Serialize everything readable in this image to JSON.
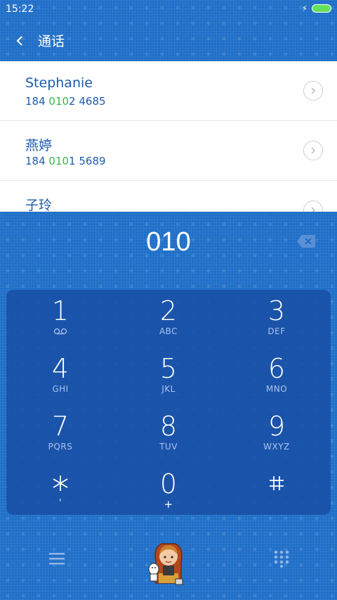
{
  "status": {
    "time": "15:22"
  },
  "header": {
    "title": "通话"
  },
  "results": [
    {
      "name": "Stephanie",
      "number_prefix": "184 ",
      "number_match": "010",
      "number_suffix": "2 4685"
    },
    {
      "name": "燕婷",
      "number_prefix": "184 ",
      "number_match": "010",
      "number_suffix": "1 5689"
    },
    {
      "name": "子玲",
      "number_prefix": "",
      "number_match": "",
      "number_suffix": ""
    }
  ],
  "dial": {
    "number": "010"
  },
  "keypad": {
    "keys": [
      {
        "digit": "1",
        "letters": ""
      },
      {
        "digit": "2",
        "letters": "ABC"
      },
      {
        "digit": "3",
        "letters": "DEF"
      },
      {
        "digit": "4",
        "letters": "GHI"
      },
      {
        "digit": "5",
        "letters": "JKL"
      },
      {
        "digit": "6",
        "letters": "MNO"
      },
      {
        "digit": "7",
        "letters": "PQRS"
      },
      {
        "digit": "8",
        "letters": "TUV"
      },
      {
        "digit": "9",
        "letters": "WXYZ"
      },
      {
        "digit": "*",
        "letters": ","
      },
      {
        "digit": "0",
        "letters": "+"
      },
      {
        "digit": "#",
        "letters": ""
      }
    ]
  },
  "colors": {
    "accent_green": "#3db34a",
    "name_blue": "#1e5aad",
    "background": "#1f6fc8"
  },
  "icons": {
    "back": "chevron-left-icon",
    "row_arrow": "chevron-right-circle-icon",
    "backspace": "backspace-icon",
    "voicemail": "voicemail-icon",
    "menu": "menu-icon",
    "call": "call-avatar-icon",
    "dialpad": "dialpad-icon"
  }
}
